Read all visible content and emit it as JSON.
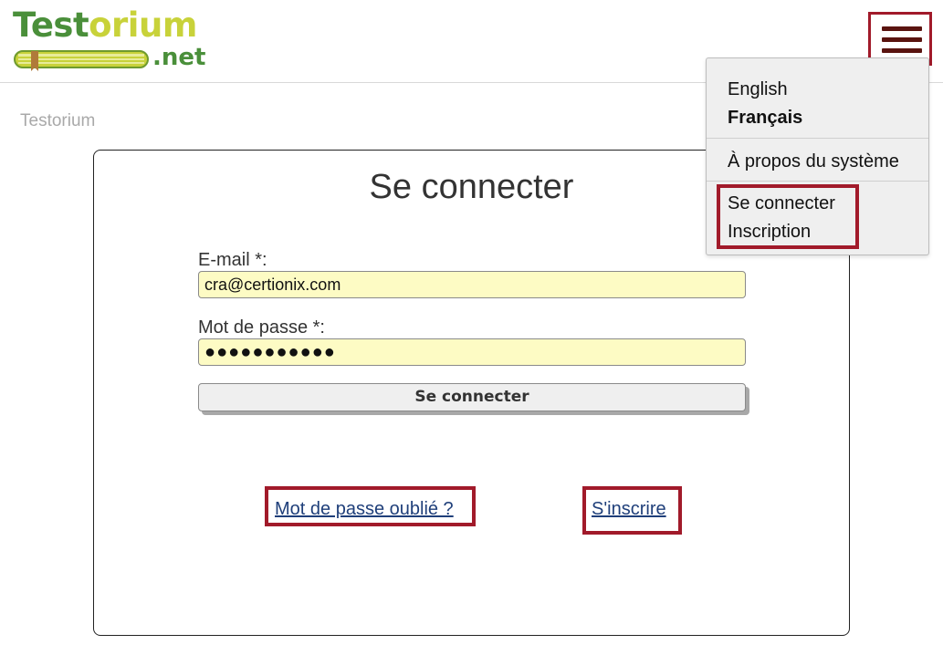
{
  "header": {
    "logo": {
      "word_part1": "Test",
      "word_part2": "orium",
      "suffix": ".net"
    },
    "menu_icon": "hamburger-menu-icon"
  },
  "breadcrumb": "Testorium",
  "login": {
    "title": "Se connecter",
    "email_label": "E-mail *:",
    "email_value": "cra@certionix.com",
    "password_label": "Mot de passe *:",
    "password_value": "●●●●●●●●●●●",
    "submit_label": "Se connecter",
    "forgot_link": "Mot de passe oublié ?",
    "register_link": "S'inscrire"
  },
  "menu": {
    "languages": [
      "English",
      "Français"
    ],
    "active_language": "Français",
    "about": "À propos du système",
    "account": [
      "Se connecter",
      "Inscription"
    ]
  },
  "colors": {
    "highlight_border": "#a11a2a",
    "input_background": "#fdfbc4",
    "logo_green": "#4a8f3a",
    "logo_lime": "#c8d23a",
    "link": "#1f3f7a",
    "menu_background": "#efefef"
  }
}
